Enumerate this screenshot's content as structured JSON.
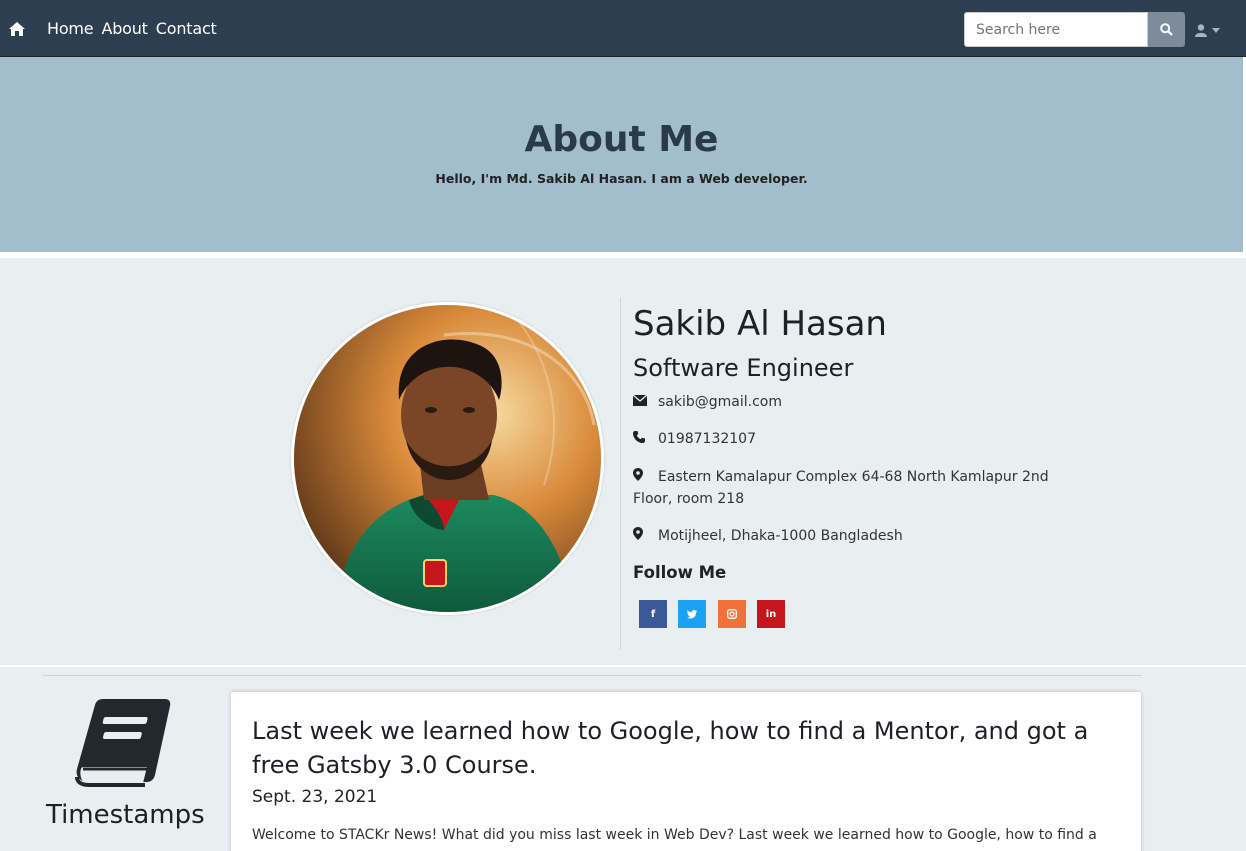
{
  "navbar": {
    "home_icon": "home-icon",
    "links": [
      "Home",
      "About",
      "Contact"
    ],
    "search_placeholder": "Search here",
    "search_icon": "search-icon",
    "user_icon": "user-icon",
    "bg_color": "#2c3e50"
  },
  "hero": {
    "title": "About Me",
    "subtitle": "Hello, I'm Md. Sakib Al Hasan. I am a Web developer.",
    "bg_color": "#a2becc"
  },
  "profile": {
    "name": "Sakib Al Hasan",
    "title": "Software Engineer",
    "email": "sakib@gmail.com",
    "phone": "01987132107",
    "address_line1": "Eastern Kamalapur Complex 64-68 North Kamlapur 2nd",
    "address_line2": "Floor, room 218",
    "location": "Motijheel, Dhaka-1000 Bangladesh",
    "follow_title": "Follow Me",
    "social": [
      {
        "icon": "facebook-icon",
        "glyph": "f",
        "color": "#3b5998"
      },
      {
        "icon": "twitter-icon",
        "glyph": "t",
        "color": "#1da1f2"
      },
      {
        "icon": "instagram-icon",
        "glyph": "◘",
        "color": "#f0713a"
      },
      {
        "icon": "linkedin-icon",
        "glyph": "in",
        "color": "#c4161c"
      }
    ]
  },
  "timestamps": {
    "label": "Timestamps",
    "icon": "book-icon",
    "post": {
      "title": "Last week we learned how to Google, how to find a Mentor, and got a free Gatsby 3.0 Course.",
      "date": "Sept. 23, 2021",
      "excerpt": "Welcome to STACKr News! What did you miss last week in Web Dev? Last week we learned how to Google, how to find a"
    }
  }
}
